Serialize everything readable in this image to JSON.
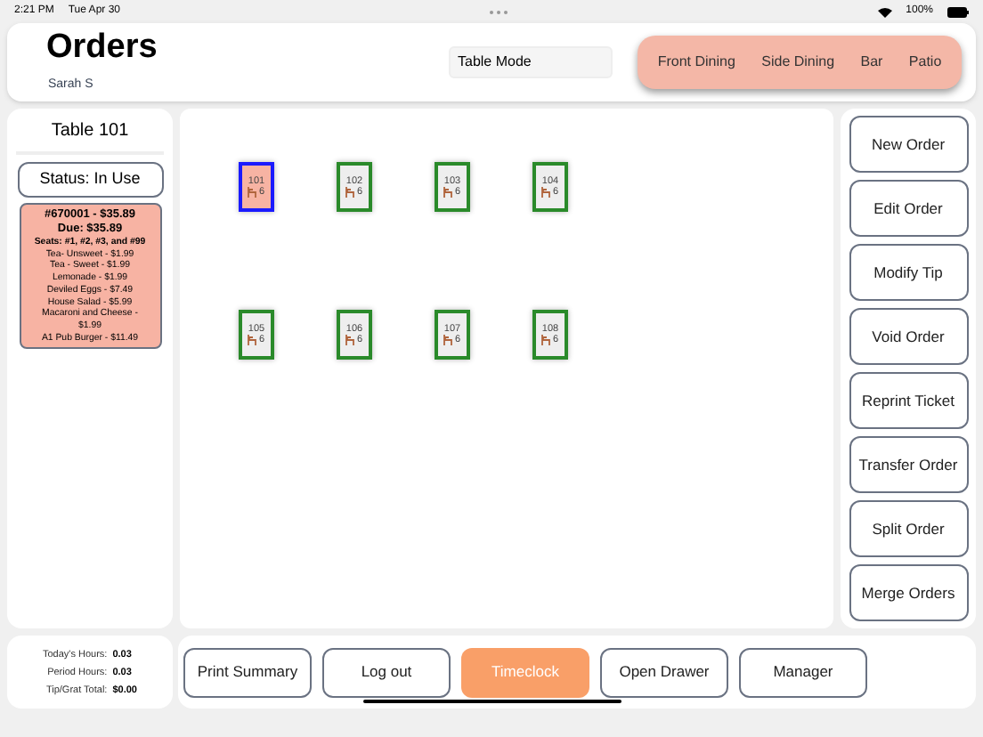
{
  "status_bar": {
    "time": "2:21 PM",
    "date": "Tue Apr 30",
    "battery": "100%"
  },
  "header": {
    "title": "Orders",
    "user": "Sarah S",
    "mode_field": "Table Mode",
    "areas": [
      "Front Dining",
      "Side Dining",
      "Bar",
      "Patio"
    ]
  },
  "table_panel": {
    "title": "Table 101",
    "status": "Status: In Use",
    "order": {
      "header": "#670001 - $35.89",
      "due": "Due: $35.89",
      "seats": "Seats: #1, #2, #3, and #99",
      "items": [
        "Tea- Unsweet - $1.99",
        "Tea - Sweet - $1.99",
        "Lemonade - $1.99",
        "Deviled Eggs - $7.49",
        "House Salad - $5.99",
        "Macaroni and Cheese - $1.99",
        "A1 Pub Burger - $11.49"
      ]
    }
  },
  "tables": [
    {
      "number": "101",
      "seats": "6",
      "selected": true
    },
    {
      "number": "102",
      "seats": "6",
      "selected": false
    },
    {
      "number": "103",
      "seats": "6",
      "selected": false
    },
    {
      "number": "104",
      "seats": "6",
      "selected": false
    },
    {
      "number": "105",
      "seats": "6",
      "selected": false
    },
    {
      "number": "106",
      "seats": "6",
      "selected": false
    },
    {
      "number": "107",
      "seats": "6",
      "selected": false
    },
    {
      "number": "108",
      "seats": "6",
      "selected": false
    }
  ],
  "actions": [
    "New Order",
    "Edit Order",
    "Modify Tip",
    "Void Order",
    "Reprint Ticket",
    "Transfer Order",
    "Split Order",
    "Merge Orders"
  ],
  "hours": [
    {
      "label": "Today's Hours:",
      "value": "0.03"
    },
    {
      "label": "Period Hours:",
      "value": "0.03"
    },
    {
      "label": "Tip/Grat Total:",
      "value": "$0.00"
    }
  ],
  "bottom_buttons": [
    {
      "label": "Print Summary",
      "kind": "outline"
    },
    {
      "label": "Log out",
      "kind": "outline"
    },
    {
      "label": "Timeclock",
      "kind": "filled"
    },
    {
      "label": "Open Drawer",
      "kind": "outline"
    },
    {
      "label": "Manager",
      "kind": "outline"
    }
  ]
}
